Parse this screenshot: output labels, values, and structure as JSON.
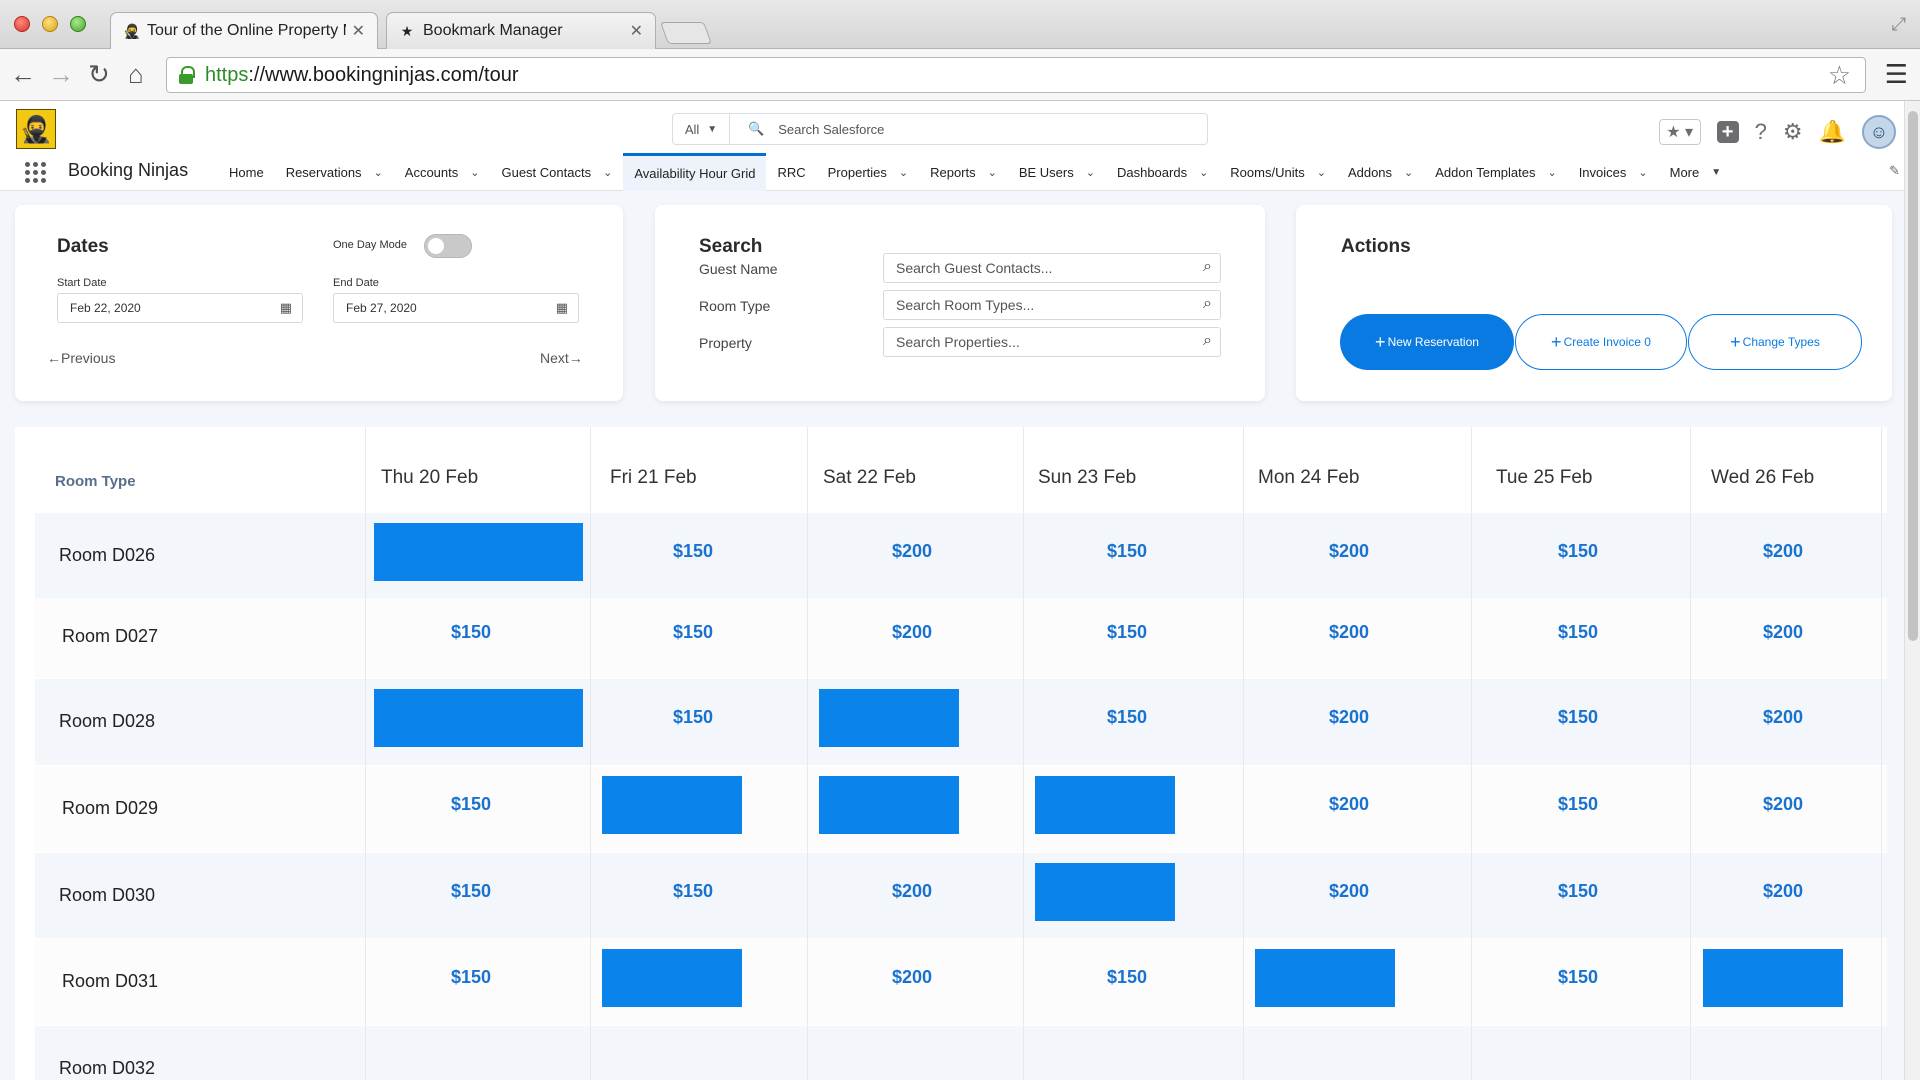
{
  "browser": {
    "tabs": [
      {
        "title": "Tour of the Online Property Ma",
        "icon": "ninja-favicon",
        "active": true
      },
      {
        "title": "Bookmark Manager",
        "icon": "star-icon",
        "active": false
      }
    ],
    "url_scheme": "https",
    "url_rest": "://www.bookingninjas.com/tour"
  },
  "header": {
    "search_scope": "All",
    "search_placeholder": "Search Salesforce"
  },
  "nav": {
    "app_name": "Booking Ninjas",
    "items": [
      {
        "label": "Home",
        "dropdown": false
      },
      {
        "label": "Reservations",
        "dropdown": true
      },
      {
        "label": "Accounts",
        "dropdown": true
      },
      {
        "label": "Guest Contacts",
        "dropdown": true
      },
      {
        "label": "Availability Hour Grid",
        "dropdown": false,
        "active": true
      },
      {
        "label": "RRC",
        "dropdown": false
      },
      {
        "label": "Properties",
        "dropdown": true
      },
      {
        "label": "Reports",
        "dropdown": true
      },
      {
        "label": "BE Users",
        "dropdown": true
      },
      {
        "label": "Dashboards",
        "dropdown": true
      },
      {
        "label": "Rooms/Units",
        "dropdown": true
      },
      {
        "label": "Addons",
        "dropdown": true
      },
      {
        "label": "Addon Templates",
        "dropdown": true
      },
      {
        "label": "Invoices",
        "dropdown": true
      },
      {
        "label": "More",
        "dropdown": true
      }
    ]
  },
  "dates": {
    "title": "Dates",
    "one_day_mode_label": "One Day Mode",
    "start_label": "Start Date",
    "start_value": "Feb 22, 2020",
    "end_label": "End Date",
    "end_value": "Feb 27, 2020",
    "previous": "Previous",
    "next": "Next"
  },
  "search": {
    "title": "Search",
    "guest_label": "Guest Name",
    "guest_placeholder": "Search Guest Contacts...",
    "room_type_label": "Room Type",
    "room_type_placeholder": "Search Room Types...",
    "property_label": "Property",
    "property_placeholder": "Search Properties..."
  },
  "actions": {
    "title": "Actions",
    "new_reservation": "New Reservation",
    "create_invoice": "Create Invoice 0",
    "change_types": "Change Types"
  },
  "grid": {
    "room_type_header": "Room Type",
    "days": [
      "Thu  20  Feb",
      "Fri 21 Feb",
      "Sat 22 Feb",
      "Sun 23 Feb",
      "Mon 24 Feb",
      "Tue 25 Feb",
      "Wed 26 Feb"
    ],
    "rows": [
      {
        "room": "Room D026",
        "cells": [
          "booked",
          "$150",
          "$200",
          "$150",
          "$200",
          "$150",
          "$200"
        ]
      },
      {
        "room": "Room D027",
        "cells": [
          "$150",
          "$150",
          "$200",
          "$150",
          "$200",
          "$150",
          "$200"
        ]
      },
      {
        "room": "Room D028",
        "cells": [
          "booked",
          "$150",
          "booked",
          "$150",
          "$200",
          "$150",
          "$200"
        ]
      },
      {
        "room": "Room D029",
        "cells": [
          "$150",
          "booked",
          "booked",
          "booked",
          "$200",
          "$150",
          "$200"
        ]
      },
      {
        "room": "Room D030",
        "cells": [
          "$150",
          "$150",
          "$200",
          "booked",
          "$200",
          "$150",
          "$200"
        ]
      },
      {
        "room": "Room D031",
        "cells": [
          "$150",
          "booked",
          "$200",
          "$150",
          "booked",
          "$150",
          "booked"
        ]
      },
      {
        "room": "Room D032",
        "cells": []
      }
    ]
  },
  "colors": {
    "accent": "#0a7ae3",
    "booked_block": "#0a84ea",
    "price_text": "#1a72cf"
  }
}
